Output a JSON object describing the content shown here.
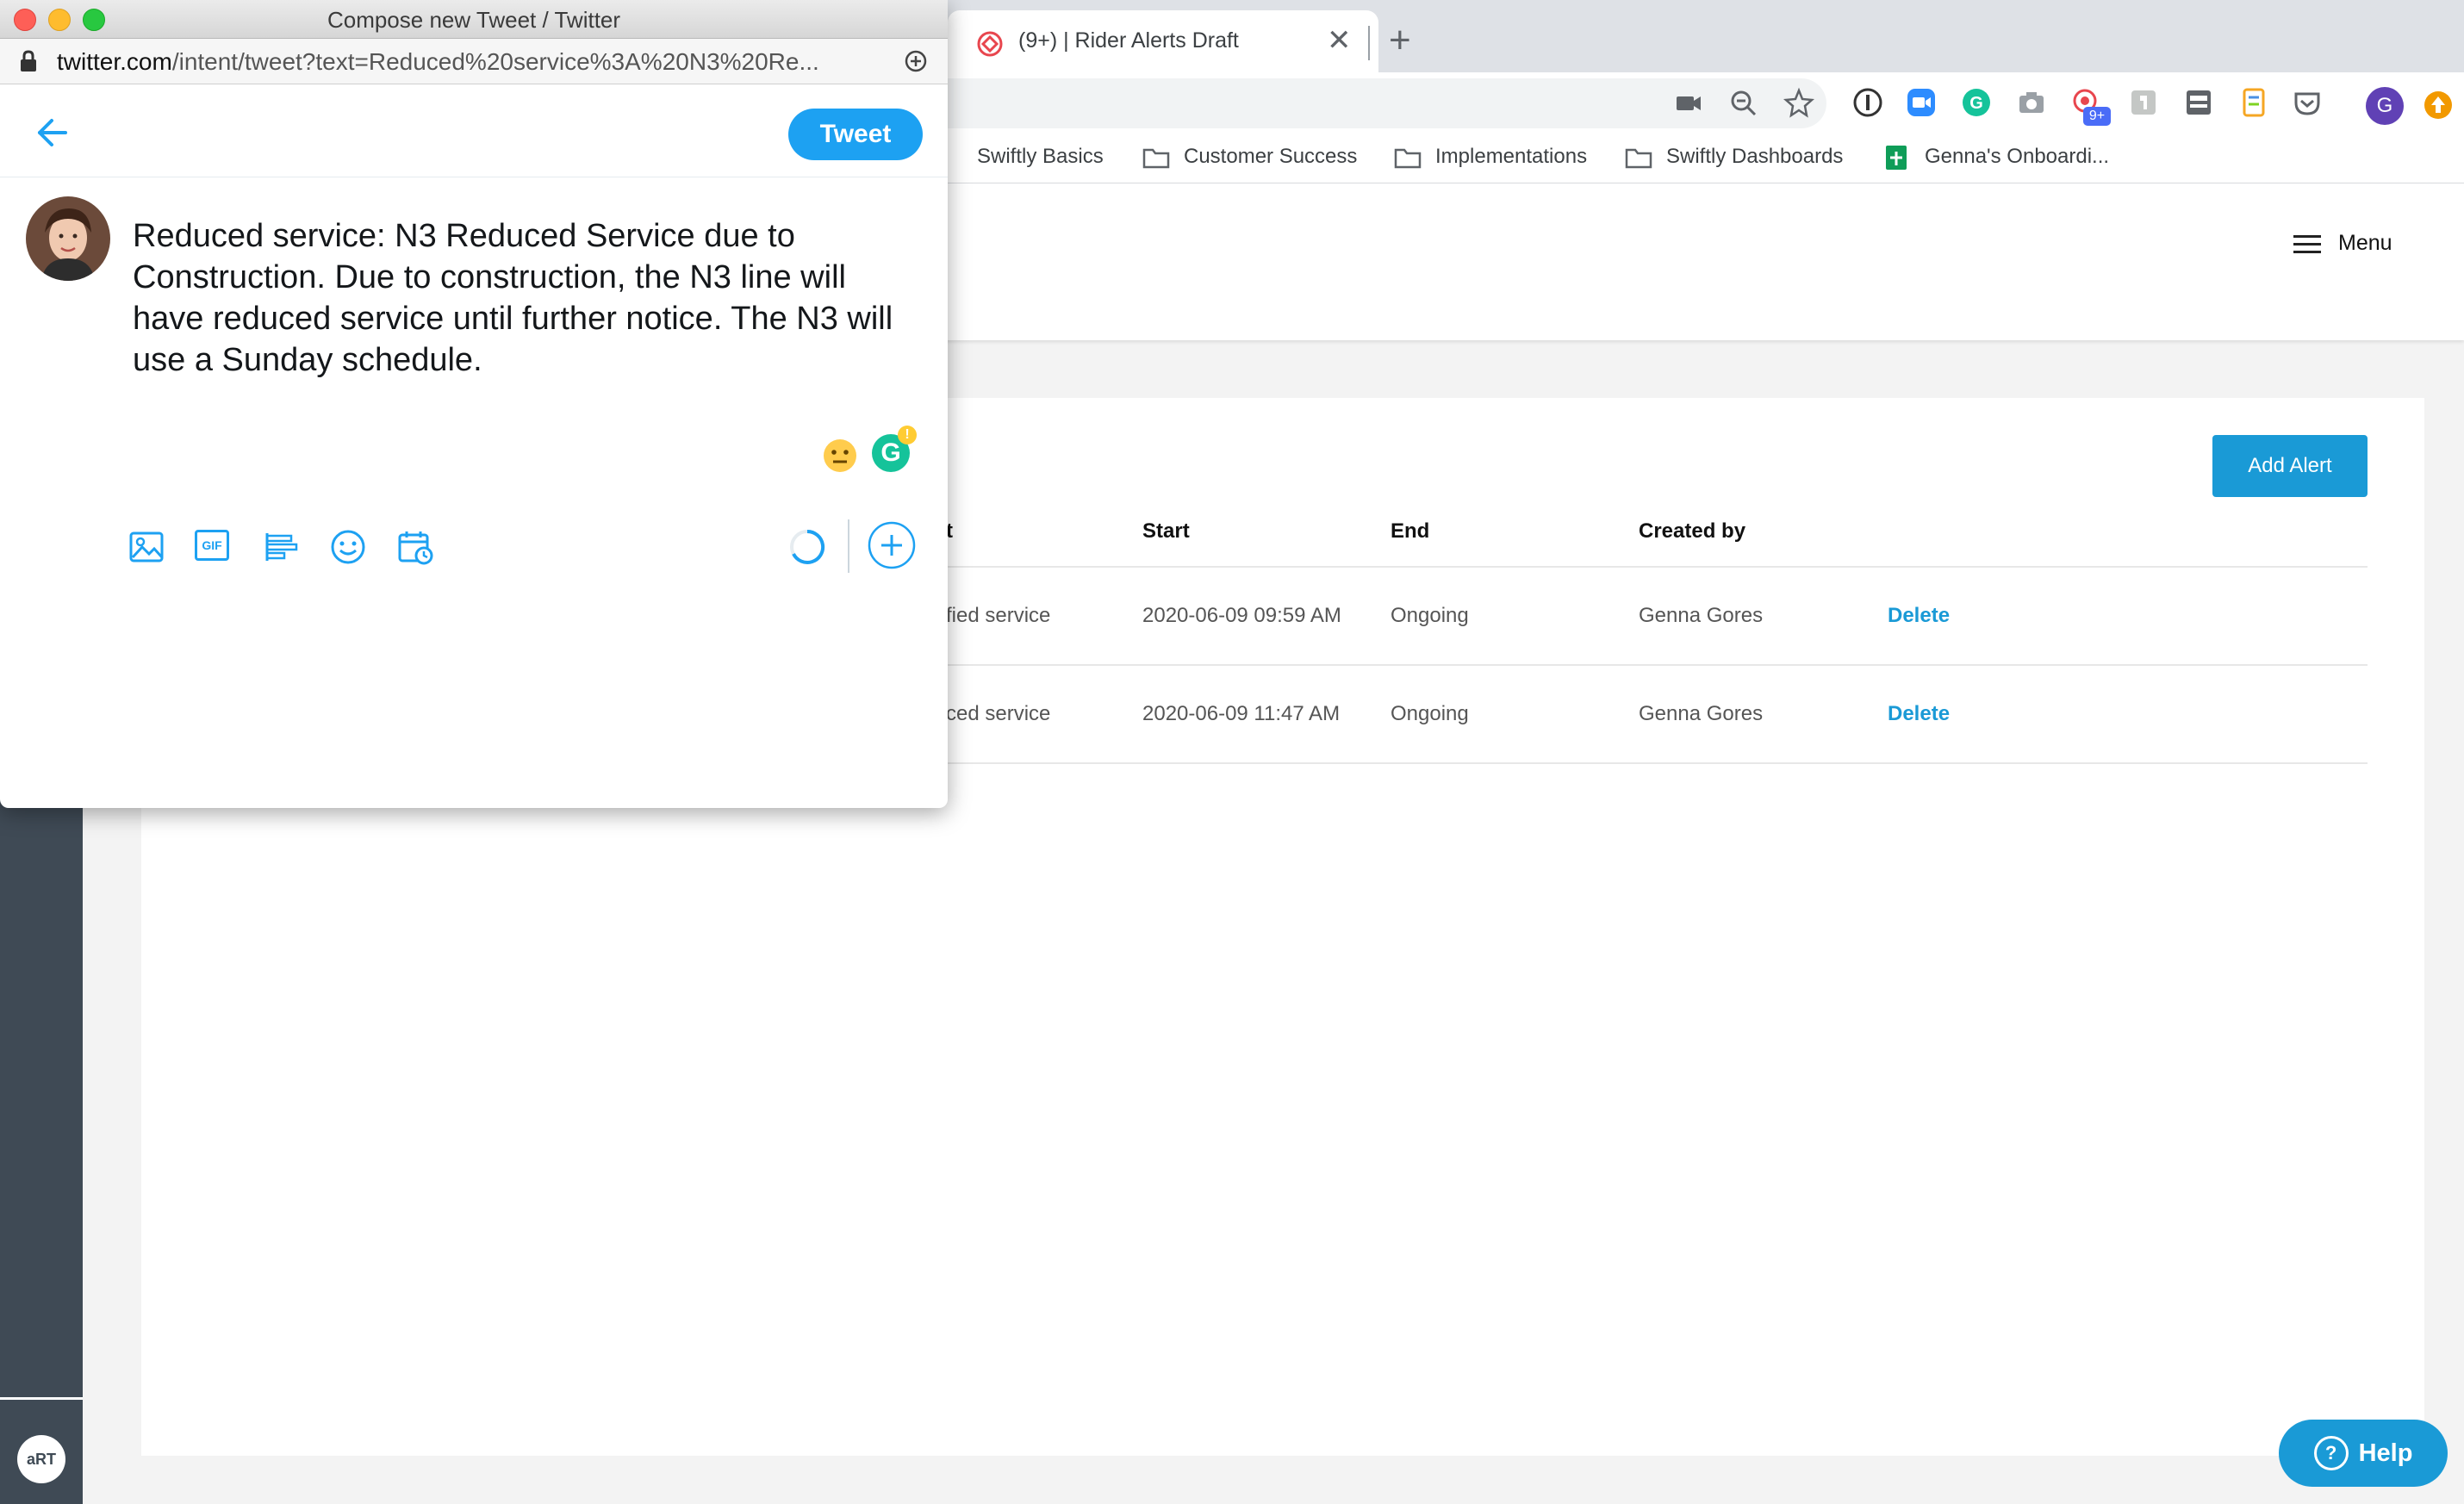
{
  "browser": {
    "tab": {
      "title": "(9+) | Rider Alerts Draft",
      "close": "✕",
      "new_tab": "+"
    },
    "bookmarks": [
      {
        "label": "Swiftly Basics",
        "type": "folder"
      },
      {
        "label": "Customer Success",
        "type": "folder"
      },
      {
        "label": "Implementations",
        "type": "folder"
      },
      {
        "label": "Swiftly Dashboards",
        "type": "folder"
      },
      {
        "label": "Genna's Onboardi...",
        "type": "sheet"
      }
    ],
    "toolbar_icons": [
      "camera-off-icon",
      "zoom-icon",
      "star-icon"
    ],
    "extensions": [
      "1password-icon",
      "zoom-ext-icon",
      "grammarly-ext-icon",
      "screenshot-icon",
      "notifications-ext-icon",
      "puzzle-ext-icon",
      "inspector-ext-icon",
      "notes-ext-icon",
      "pocket-icon",
      "profile-avatar",
      "update-icon"
    ],
    "extension_badge": "9+",
    "profile_initial": "G"
  },
  "app": {
    "menu_label": "Menu",
    "add_alert_label": "Add Alert",
    "sidebar_logo": "aRT",
    "table": {
      "headers": [
        "t",
        "Start",
        "End",
        "Created by"
      ],
      "rows": [
        {
          "alert": "fied service",
          "start": "2020-06-09 09:59 AM",
          "end": "Ongoing",
          "created_by": "Genna Gores",
          "action": "Delete"
        },
        {
          "alert": "ced service",
          "start": "2020-06-09 11:47 AM",
          "end": "Ongoing",
          "created_by": "Genna Gores",
          "action": "Delete"
        }
      ]
    },
    "help_label": "Help",
    "help_icon": "?"
  },
  "popup": {
    "window_title": "Compose new Tweet / Twitter",
    "url_host": "twitter.com",
    "url_path": "/intent/tweet?text=Reduced%20service%3A%20N3%20Re...",
    "tweet_button": "Tweet",
    "tweet_text": "Reduced service: N3 Reduced Service due to Construction. Due to construction, the N3 line will have reduced service until further notice. The N3 will use a Sunday schedule.",
    "grammarly_letter": "G",
    "grammarly_alert": "!",
    "tools": [
      "image-icon",
      "gif-icon",
      "poll-icon",
      "emoji-icon",
      "schedule-icon"
    ],
    "gif_text": "GIF"
  },
  "colors": {
    "twitter_blue": "#1da1f2",
    "swiftly_blue": "#1a9ad6",
    "sidebar": "#3f4a55",
    "grammarly": "#15c39a"
  }
}
